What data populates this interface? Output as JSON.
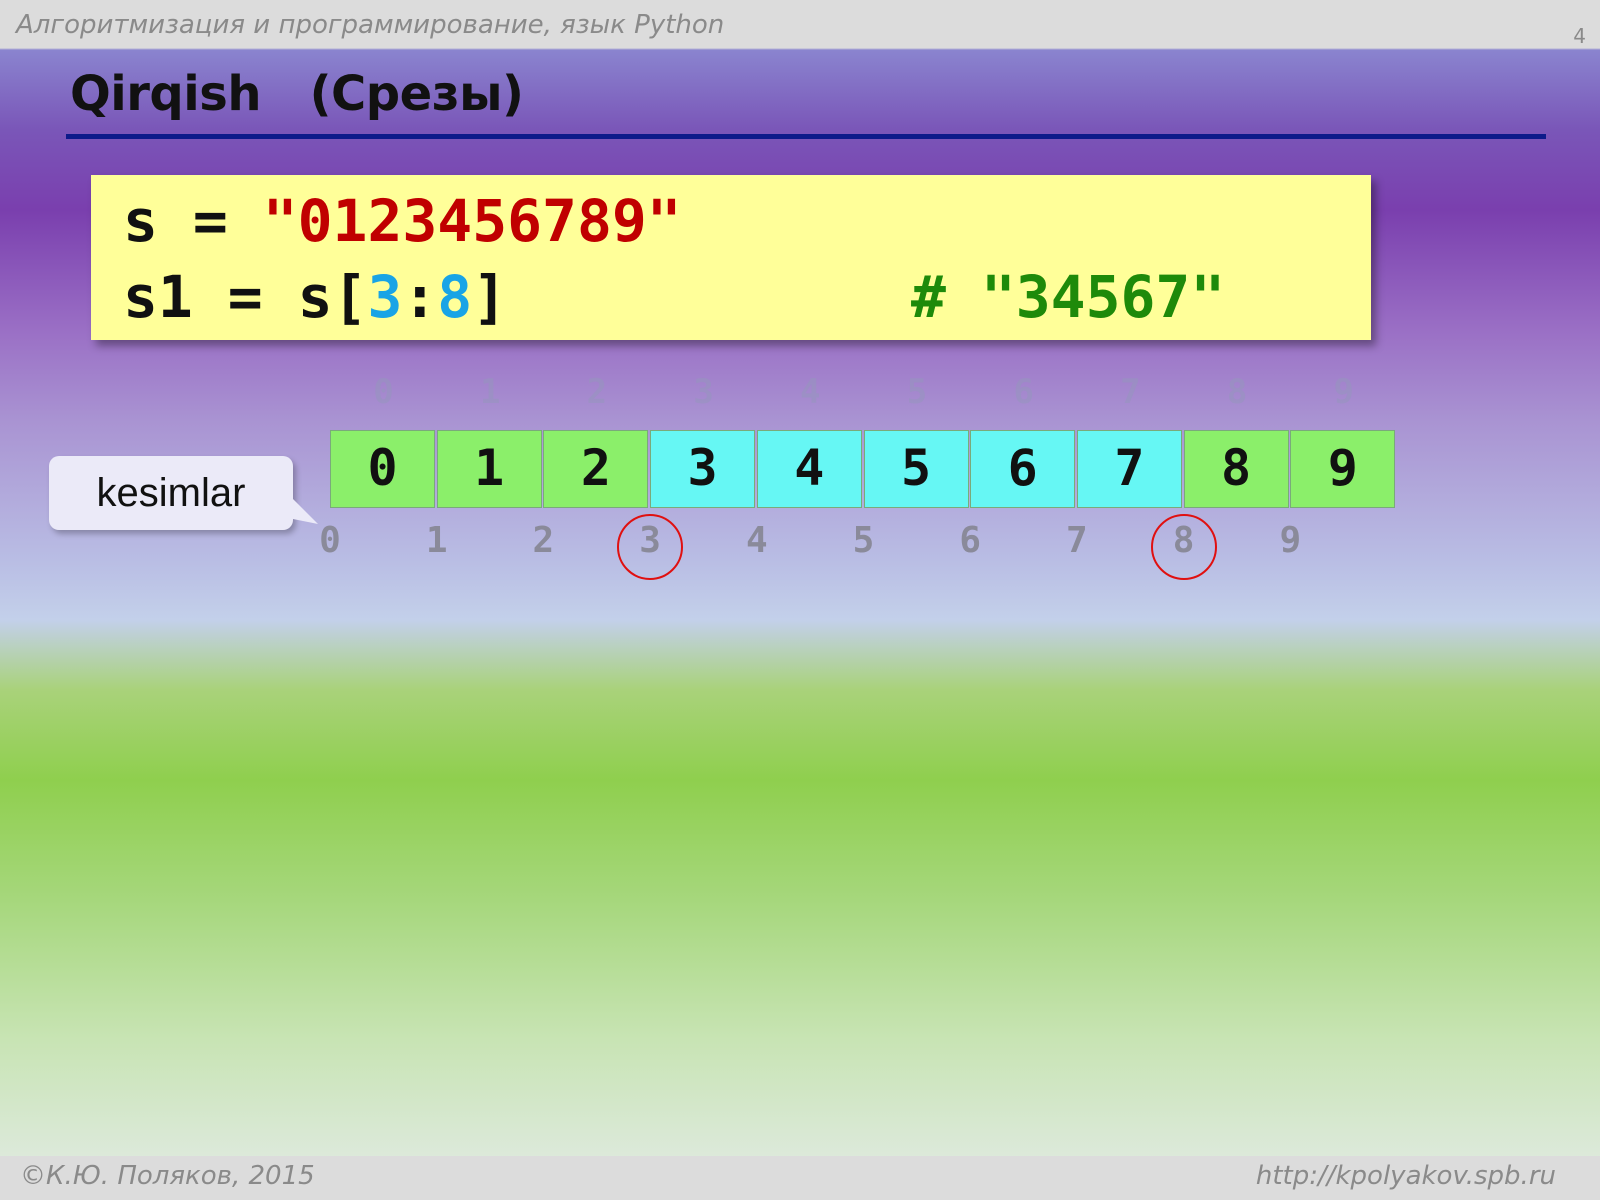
{
  "header": {
    "course_title": "Алгоритмизация и программирование, язык Python",
    "page_number": "4"
  },
  "slide": {
    "title": "Qirqish   (Срезы)"
  },
  "code": {
    "line1": {
      "var": "s",
      "eq": " = ",
      "string": "\"0123456789\""
    },
    "line2": {
      "var": "s1",
      "eq": " = ",
      "obj": "s",
      "open": "[",
      "start": "3",
      "colon": ":",
      "end": "8",
      "close": "]"
    },
    "comment": "# \"34567\""
  },
  "top_indices": [
    "0",
    "1",
    "2",
    "3",
    "4",
    "5",
    "6",
    "7",
    "8",
    "9"
  ],
  "cells": [
    {
      "value": "0",
      "state": "green"
    },
    {
      "value": "1",
      "state": "green"
    },
    {
      "value": "2",
      "state": "green"
    },
    {
      "value": "3",
      "state": "cyan"
    },
    {
      "value": "4",
      "state": "cyan"
    },
    {
      "value": "5",
      "state": "cyan"
    },
    {
      "value": "6",
      "state": "cyan"
    },
    {
      "value": "7",
      "state": "cyan"
    },
    {
      "value": "8",
      "state": "green"
    },
    {
      "value": "9",
      "state": "green"
    }
  ],
  "bottom_indices": [
    "0",
    "1",
    "2",
    "3",
    "4",
    "5",
    "6",
    "7",
    "8",
    "9"
  ],
  "circled_indices": [
    "3",
    "8"
  ],
  "callout": {
    "label": "kesimlar"
  },
  "footer": {
    "copyright": "©К.Ю. Поляков, 2015",
    "url": "http://kpolyakov.spb.ru"
  },
  "colors": {
    "slice_cell": "#66f7f4",
    "other_cell": "#8bef6a",
    "string_literal": "#c00000",
    "slice_numbers": "#19a4e6",
    "comment": "#1e8a0a",
    "highlight_circle": "#e01010",
    "title_rule": "#0d1a8a"
  }
}
